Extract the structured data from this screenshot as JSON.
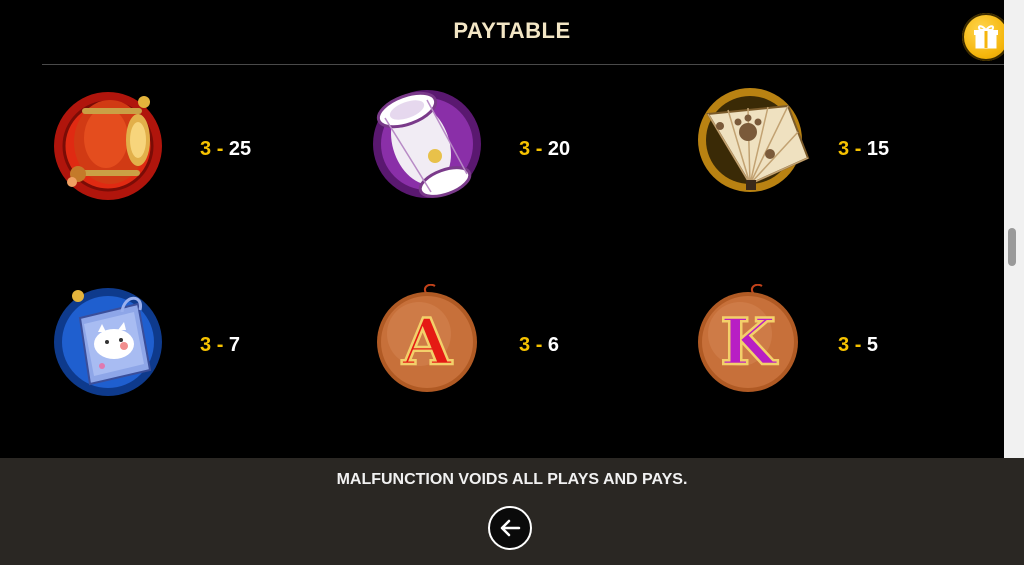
{
  "header": {
    "title": "PAYTABLE",
    "gift_icon": "gift-icon"
  },
  "symbols": [
    {
      "name": "lantern",
      "icon": "lantern-icon",
      "count": "3",
      "sep": "-",
      "payout": "25"
    },
    {
      "name": "drum",
      "icon": "drum-icon",
      "count": "3",
      "sep": "-",
      "payout": "20"
    },
    {
      "name": "fan",
      "icon": "fan-icon",
      "count": "3",
      "sep": "-",
      "payout": "15"
    },
    {
      "name": "charm",
      "icon": "cat-charm-icon",
      "count": "3",
      "sep": "-",
      "payout": "7"
    },
    {
      "name": "A",
      "icon": "letter-a-icon",
      "letter": "A",
      "count": "3",
      "sep": "-",
      "payout": "6"
    },
    {
      "name": "K",
      "icon": "letter-k-icon",
      "letter": "K",
      "count": "3",
      "sep": "-",
      "payout": "5"
    }
  ],
  "footer": {
    "disclaimer": "MALFUNCTION VOIDS ALL PLAYS AND PAYS.",
    "back_icon": "back-arrow-icon"
  },
  "colors": {
    "background": "#000000",
    "title": "#f3e6c5",
    "count_accent": "#f6c200",
    "payout_text": "#ffffff",
    "footer_bg": "#2a2723",
    "gift_bg": "#f5b60c"
  }
}
